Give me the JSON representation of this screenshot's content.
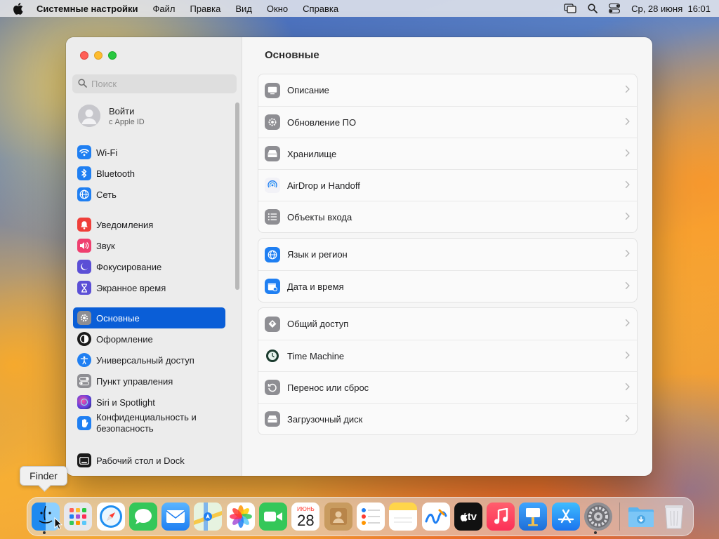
{
  "menubar": {
    "app_name": "Системные настройки",
    "items": [
      "Файл",
      "Правка",
      "Вид",
      "Окно",
      "Справка"
    ],
    "datetime": "Ср, 28 июня  16:01"
  },
  "window": {
    "search": {
      "placeholder": "Поиск"
    },
    "account": {
      "title": "Войти",
      "subtitle": "с Apple ID"
    },
    "sidebar": [
      {
        "label": "Wi-Fi",
        "icon": "wifi-icon",
        "color": "#1f7ff2"
      },
      {
        "label": "Bluetooth",
        "icon": "bluetooth-icon",
        "color": "#1f7ff2"
      },
      {
        "label": "Сеть",
        "icon": "globe-icon",
        "color": "#1f7ff2"
      },
      {
        "label": "Уведомления",
        "icon": "bell-icon",
        "color": "#ef3f3a"
      },
      {
        "label": "Звук",
        "icon": "speaker-icon",
        "color": "#ef3f6f"
      },
      {
        "label": "Фокусирование",
        "icon": "moon-icon",
        "color": "#5b4fd6"
      },
      {
        "label": "Экранное время",
        "icon": "hourglass-icon",
        "color": "#5b4fd6"
      },
      {
        "label": "Основные",
        "icon": "gear-icon",
        "color": "#8e8e93",
        "selected": true
      },
      {
        "label": "Оформление",
        "icon": "appearance-icon",
        "color": "#1a1a1a"
      },
      {
        "label": "Универсальный доступ",
        "icon": "accessibility-icon",
        "color": "#1f7ff2"
      },
      {
        "label": "Пункт управления",
        "icon": "toggles-icon",
        "color": "#8e8e93"
      },
      {
        "label": "Siri и Spotlight",
        "icon": "siri-icon",
        "color": "#7a3fd1"
      },
      {
        "label": "Конфиденциальность и безопасность",
        "icon": "hand-icon",
        "color": "#1f7ff2"
      },
      {
        "label": "Рабочий стол и Dock",
        "icon": "desktop-dock-icon",
        "color": "#1a1a1a"
      }
    ],
    "content": {
      "title": "Основные",
      "groups": [
        [
          {
            "label": "Описание",
            "icon": "display-icon"
          },
          {
            "label": "Обновление ПО",
            "icon": "gear-badge-icon"
          },
          {
            "label": "Хранилище",
            "icon": "storage-icon"
          },
          {
            "label": "AirDrop и Handoff",
            "icon": "airdrop-icon"
          },
          {
            "label": "Объекты входа",
            "icon": "list-icon"
          }
        ],
        [
          {
            "label": "Язык и регион",
            "icon": "globe-icon"
          },
          {
            "label": "Дата и время",
            "icon": "calendar-clock-icon"
          }
        ],
        [
          {
            "label": "Общий доступ",
            "icon": "sharing-icon"
          },
          {
            "label": "Time Machine",
            "icon": "time-machine-icon"
          },
          {
            "label": "Перенос или сброс",
            "icon": "reset-icon"
          },
          {
            "label": "Загрузочный диск",
            "icon": "disk-icon"
          }
        ]
      ]
    }
  },
  "tooltip": "Finder",
  "dock": {
    "calendar_month": "ИЮНЬ",
    "calendar_day": "28",
    "tv_label": "tv",
    "apps": [
      "Finder",
      "Launchpad",
      "Safari",
      "Сообщения",
      "Почта",
      "Карты",
      "Фото",
      "FaceTime",
      "Календарь",
      "Контакты",
      "Напоминания",
      "Заметки",
      "Freeform",
      "TV",
      "Музыка",
      "Keynote",
      "App Store",
      "Системные настройки",
      "Загрузки",
      "Корзина"
    ]
  }
}
